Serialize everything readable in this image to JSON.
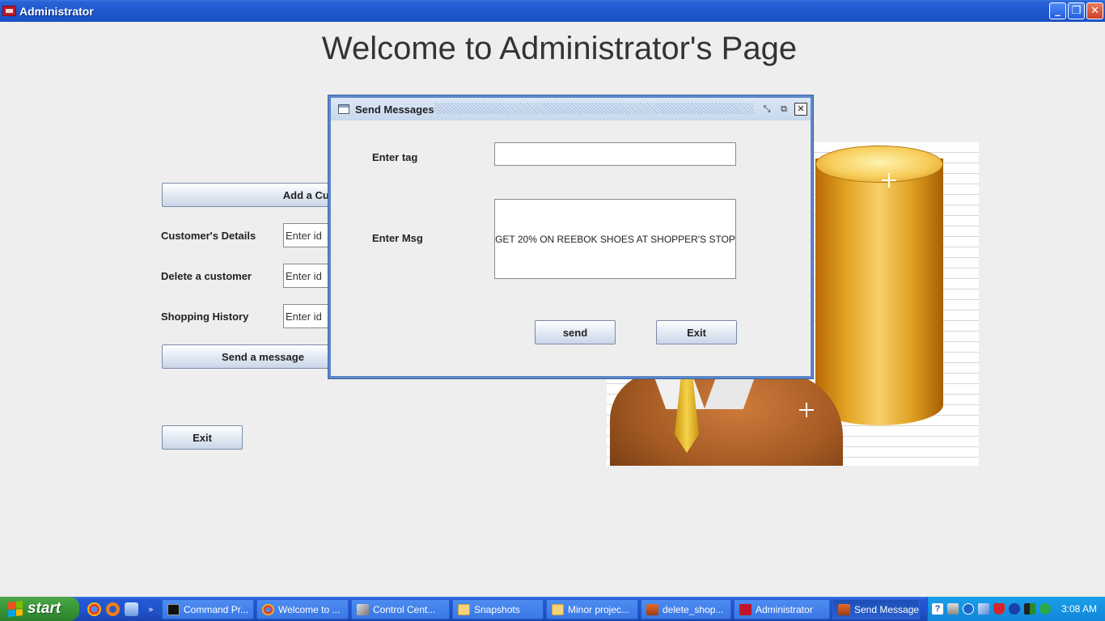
{
  "window": {
    "title": "Administrator",
    "buttons": {
      "minimize": "_",
      "maximize": "❐",
      "close": "✕"
    }
  },
  "page": {
    "heading": "Welcome to Administrator's Page"
  },
  "actions": {
    "add_customer": "Add a Customer",
    "customers_details_label": "Customer's Details",
    "delete_customer_label": "Delete a customer",
    "shopping_history_label": "Shopping History",
    "id_placeholder": "Enter id",
    "send_message": "Send a message",
    "exit": "Exit"
  },
  "dialog": {
    "title": "Send Messages",
    "tag_label": "Enter tag",
    "tag_value": "",
    "msg_label": "Enter Msg",
    "msg_value": "GET 20% ON REEBOK SHOES AT SHOPPER'S STOP",
    "send_button": "send",
    "exit_button": "Exit"
  },
  "taskbar": {
    "start": "start",
    "tasks": [
      {
        "label": "Command Pr...",
        "icon": "cmd-icon",
        "active": false
      },
      {
        "label": "Welcome to ...",
        "icon": "chrome-icon",
        "active": false
      },
      {
        "label": "Control Cent...",
        "icon": "network-icon",
        "active": false
      },
      {
        "label": "Snapshots",
        "icon": "folder-icon",
        "active": false
      },
      {
        "label": "Minor projec...",
        "icon": "folder-icon",
        "active": false
      },
      {
        "label": "delete_shop...",
        "icon": "java-icon",
        "active": false
      },
      {
        "label": "Administrator",
        "icon": "app-icon",
        "active": false
      },
      {
        "label": "Send Messages",
        "icon": "java-icon",
        "active": true
      }
    ],
    "clock": "3:08 AM"
  }
}
